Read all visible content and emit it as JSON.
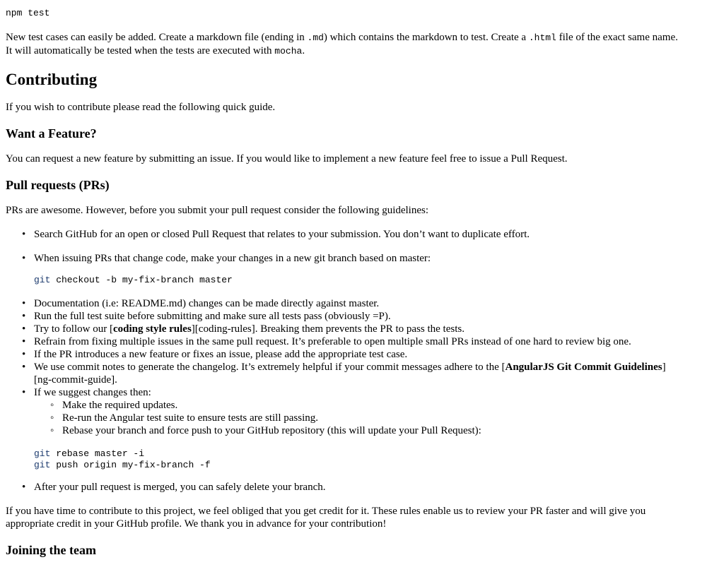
{
  "top_code": "npm test",
  "intro": {
    "p1a": "New test cases can easily be added. Create a markdown file (ending in ",
    "p1_code1": ".md",
    "p1b": ") which contains the markdown to test. Create a ",
    "p1_code2": ".html",
    "p1c": " file of the exact same name.",
    "p2a": "It will automatically be tested when the tests are executed with ",
    "p2_code": "mocha",
    "p2b": "."
  },
  "contrib": {
    "title": "Contributing",
    "desc": "If you wish to contribute please read the following quick guide."
  },
  "feature": {
    "title": "Want a Feature?",
    "desc": "You can request a new feature by submitting an issue. If you would like to implement a new feature feel free to issue a Pull Request."
  },
  "prs": {
    "title": "Pull requests (PRs)",
    "desc": "PRs are awesome. However, before you submit your pull request consider the following guidelines:",
    "item1": "Search GitHub for an open or closed Pull Request that relates to your submission. You don’t want to duplicate effort.",
    "item2": "When issuing PRs that change code, make your changes in a new git branch based on master:",
    "code1_kw": "git",
    "code1_rest": " checkout -b my-fix-branch master",
    "item3": "Documentation (i.e: README.md) changes can be made directly against master.",
    "item4": "Run the full test suite before submitting and make sure all tests pass (obviously =P).",
    "item5a": "Try to follow our [",
    "item5b": "coding style rules",
    "item5c": "][coding-rules]. Breaking them prevents the PR to pass the tests.",
    "item6": "Refrain from fixing multiple issues in the same pull request. It’s preferable to open multiple small PRs instead of one hard to review big one.",
    "item7": "If the PR introduces a new feature or fixes an issue, please add the appropriate test case.",
    "item8a": "We use commit notes to generate the changelog. It’s extremely helpful if your commit messages adhere to the [",
    "item8b": "AngularJS Git Commit Guidelines",
    "item8c": "]",
    "item8d": "[ng-commit-guide].",
    "item9": "If we suggest changes then:",
    "sub1": "Make the required updates.",
    "sub2": "Re-run the Angular test suite to ensure tests are still passing.",
    "sub3": "Rebase your branch and force push to your GitHub repository (this will update your Pull Request):",
    "code2_l1_kw": "git",
    "code2_l1_rest": " rebase master -i",
    "code2_l2_kw": "git",
    "code2_l2_rest": " push origin my-fix-branch -f",
    "item10": "After your pull request is merged, you can safely delete your branch."
  },
  "closing": {
    "l1": "If you have time to contribute to this project, we feel obliged that you get credit for it. These rules enable us to review your PR faster and will give you",
    "l2": "appropriate credit in your GitHub profile. We thank you in advance for your contribution!"
  },
  "joining": {
    "title": "Joining the team"
  }
}
